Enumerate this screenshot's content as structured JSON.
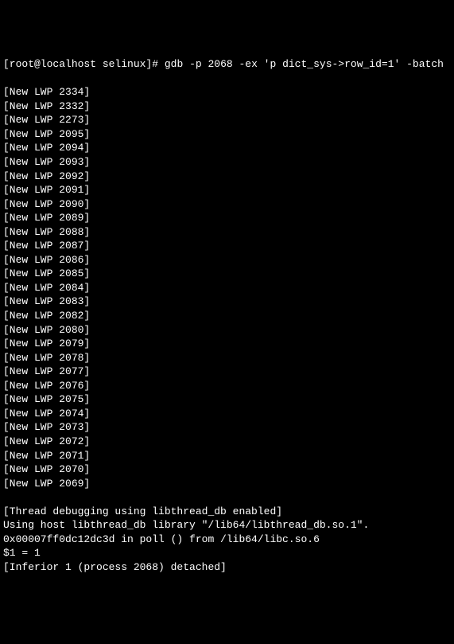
{
  "prompt": {
    "user_host": "[root@localhost selinux]#",
    "command": "gdb -p 2068 -ex 'p dict_sys->row_id=1' -batch"
  },
  "lwp_lines": [
    "[New LWP 2334]",
    "[New LWP 2332]",
    "[New LWP 2273]",
    "[New LWP 2095]",
    "[New LWP 2094]",
    "[New LWP 2093]",
    "[New LWP 2092]",
    "[New LWP 2091]",
    "[New LWP 2090]",
    "[New LWP 2089]",
    "[New LWP 2088]",
    "[New LWP 2087]",
    "[New LWP 2086]",
    "[New LWP 2085]",
    "[New LWP 2084]",
    "[New LWP 2083]",
    "[New LWP 2082]",
    "[New LWP 2080]",
    "[New LWP 2079]",
    "[New LWP 2078]",
    "[New LWP 2077]",
    "[New LWP 2076]",
    "[New LWP 2075]",
    "[New LWP 2074]",
    "[New LWP 2073]",
    "[New LWP 2072]",
    "[New LWP 2071]",
    "[New LWP 2070]",
    "[New LWP 2069]"
  ],
  "footer_lines": [
    "[Thread debugging using libthread_db enabled]",
    "Using host libthread_db library \"/lib64/libthread_db.so.1\".",
    "0x00007ff0dc12dc3d in poll () from /lib64/libc.so.6",
    "$1 = 1",
    "[Inferior 1 (process 2068) detached]"
  ]
}
